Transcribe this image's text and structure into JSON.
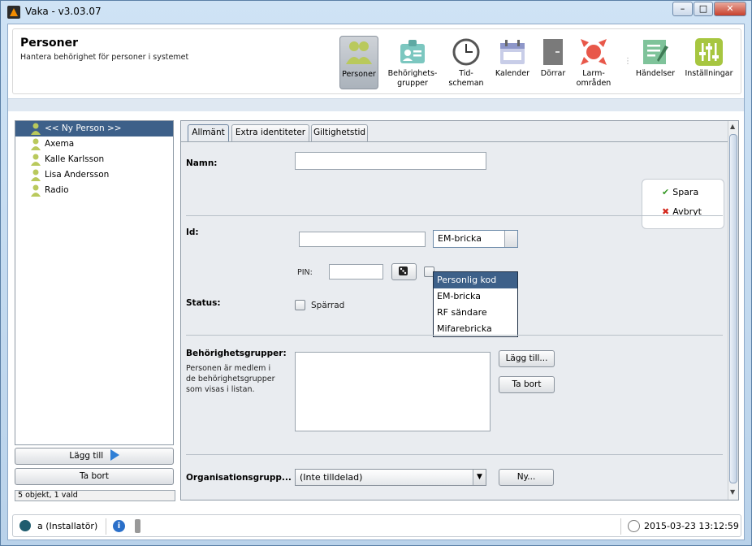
{
  "window": {
    "title": "Vaka - v3.03.07",
    "minimize": "–",
    "maximize": "□",
    "close": "✕"
  },
  "header": {
    "title": "Personer",
    "subtitle": "Hantera behörighet för personer i systemet",
    "tools": [
      {
        "label": "Personer",
        "icon": "persons-icon"
      },
      {
        "label": "Behörighets-\ngrupper",
        "icon": "badge-icon"
      },
      {
        "label": "Tid-\nscheman",
        "icon": "clock-icon"
      },
      {
        "label": "Kalender",
        "icon": "calendar-icon"
      },
      {
        "label": "Dörrar",
        "icon": "door-icon"
      },
      {
        "label": "Larm-\nområden",
        "icon": "alarm-icon"
      },
      {
        "label": "Händelser",
        "icon": "events-icon"
      },
      {
        "label": "Inställningar",
        "icon": "settings-icon"
      }
    ]
  },
  "persons": [
    {
      "name": "<< Ny Person >>"
    },
    {
      "name": "Axema"
    },
    {
      "name": "Kalle Karlsson"
    },
    {
      "name": "Lisa Andersson"
    },
    {
      "name": "Radio"
    }
  ],
  "left_buttons": {
    "add": "Lägg till",
    "remove": "Ta bort"
  },
  "object_count": "5 objekt, 1 vald",
  "tabs": [
    "Allmänt",
    "Extra identiteter",
    "Giltighetstid"
  ],
  "form": {
    "name_label": "Namn:",
    "name_value": "",
    "id_label": "Id:",
    "id_value": "",
    "id_type_selected": "EM-bricka",
    "id_type_options": [
      "Personlig kod",
      "EM-bricka",
      "RF sändare",
      "Mifarebricka"
    ],
    "pin_label": "PIN:",
    "pin_value": "",
    "status_label": "Status:",
    "blocked_label": "Spärrad",
    "groups_label": "Behörighetsgrupper:",
    "groups_help": "Personen är medlem i\nde behörighetsgrupper\nsom visas i listan.",
    "groups_add": "Lägg till...",
    "groups_remove": "Ta bort",
    "org_label": "Organisationsgrupp...",
    "org_selected": "(Inte tilldelad)",
    "org_new": "Ny..."
  },
  "actions": {
    "save": "Spara",
    "cancel": "Avbryt"
  },
  "status": {
    "user": "a (Installatör)",
    "datetime": "2015-03-23 13:12:59"
  },
  "colors": {
    "selection": "#3d6089",
    "accent_green": "#a7c640",
    "alarm_red": "#e8584a"
  }
}
